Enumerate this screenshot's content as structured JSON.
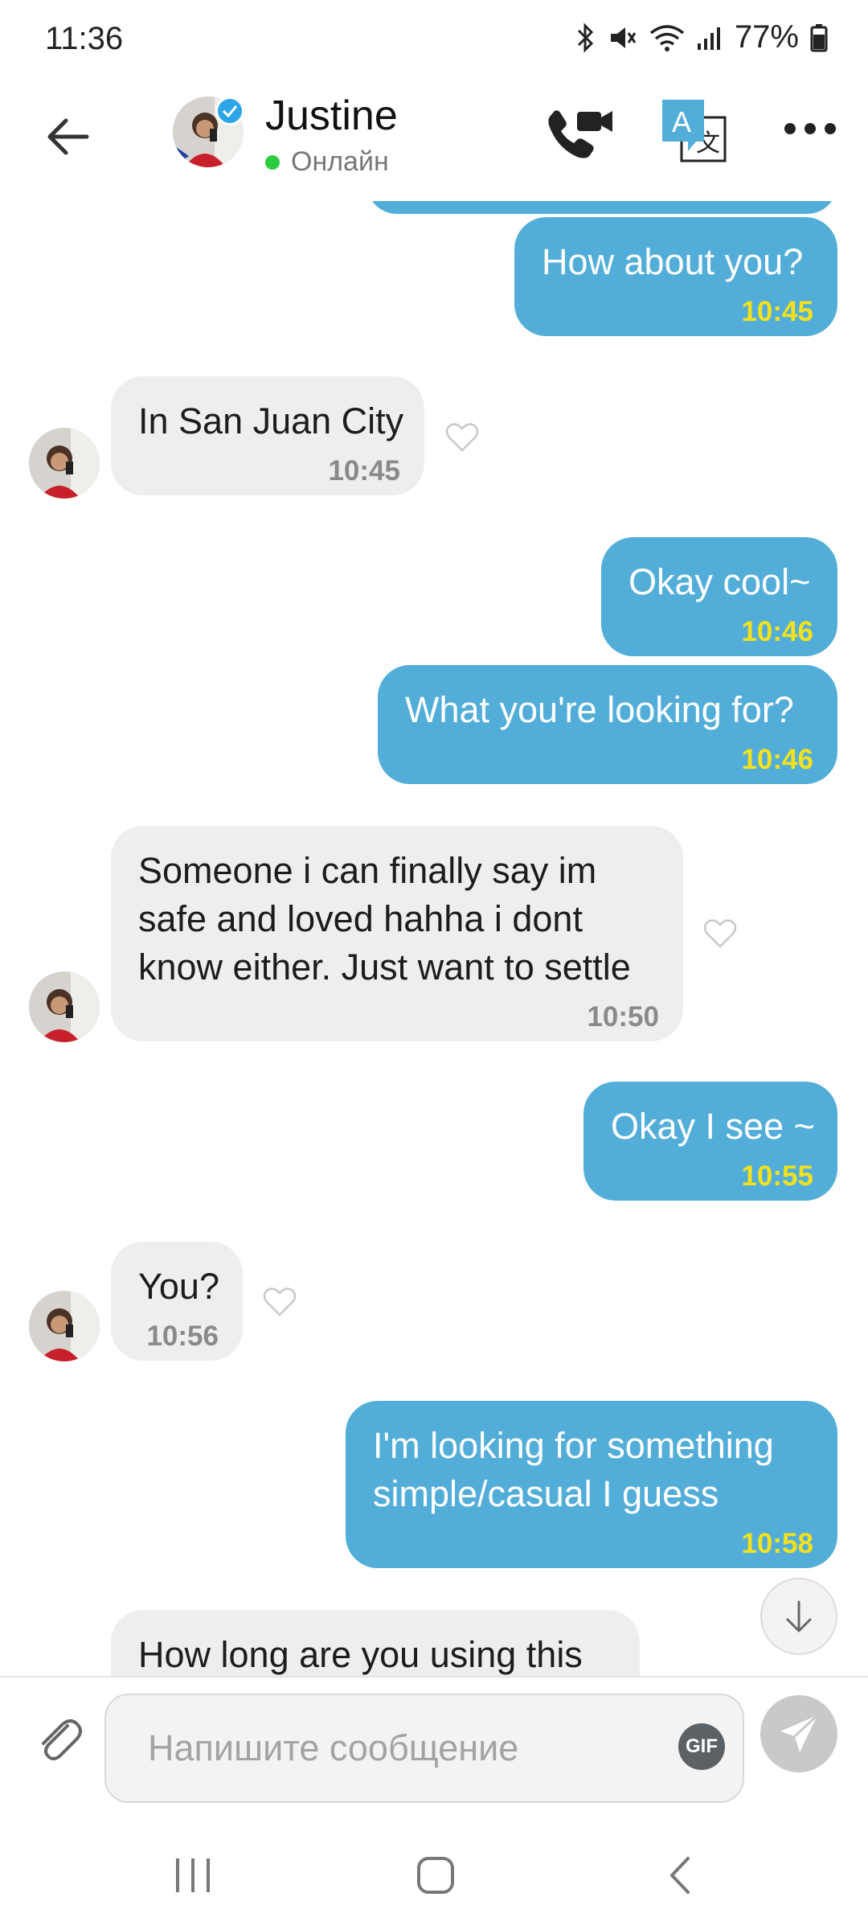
{
  "status_bar": {
    "time": "11:36",
    "battery": "77%"
  },
  "header": {
    "contact_name": "Justine",
    "status": "Онлайн"
  },
  "messages": [
    {
      "direction": "out",
      "text": "How about you?",
      "time": "10:45"
    },
    {
      "direction": "in",
      "text": "In San Juan City",
      "time": "10:45"
    },
    {
      "direction": "out",
      "text": "Okay cool~",
      "time": "10:46"
    },
    {
      "direction": "out",
      "text": "What you're looking for?",
      "time": "10:46"
    },
    {
      "direction": "in",
      "text": "Someone i can finally say im\nsafe and loved hahha i dont\nknow either. Just want to settle",
      "time": "10:50"
    },
    {
      "direction": "out",
      "text": "Okay I see ~",
      "time": "10:55"
    },
    {
      "direction": "in",
      "text": "You?",
      "time": "10:56"
    },
    {
      "direction": "out",
      "text": "I'm looking for something\nsimple/casual I guess",
      "time": "10:58"
    },
    {
      "direction": "in",
      "text": "How long are you using this",
      "time": ""
    }
  ],
  "composer": {
    "placeholder": "Напишите сообщение",
    "gif_label": "GIF"
  },
  "colors": {
    "outgoing_bubble": "#52aed8",
    "incoming_bubble": "#efeeed",
    "outgoing_time": "#f2e21e",
    "online_dot": "#2ecc40"
  },
  "icons": [
    "back-arrow-icon",
    "verified-icon",
    "video-call-icon",
    "translate-icon",
    "more-icon",
    "heart-icon",
    "arrow-down-icon",
    "paperclip-icon",
    "send-icon",
    "recents-icon",
    "home-icon",
    "back-nav-icon"
  ]
}
